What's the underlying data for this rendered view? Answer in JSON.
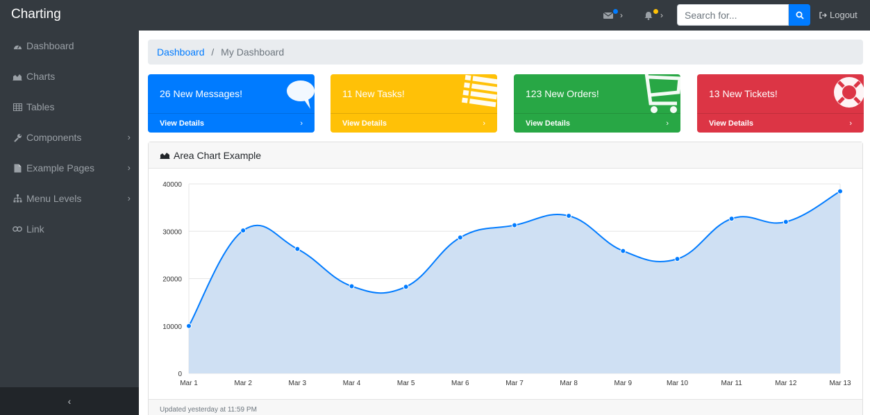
{
  "app": {
    "brand": "Charting"
  },
  "navbar": {
    "search_placeholder": "Search for...",
    "logout_label": "Logout",
    "messages_dot_color": "#007bff",
    "alerts_dot_color": "#ffc107"
  },
  "sidebar": {
    "items": [
      {
        "label": "Dashboard",
        "icon": "dashboard-icon"
      },
      {
        "label": "Charts",
        "icon": "area-chart-icon"
      },
      {
        "label": "Tables",
        "icon": "table-icon"
      },
      {
        "label": "Components",
        "icon": "wrench-icon",
        "expandable": true
      },
      {
        "label": "Example Pages",
        "icon": "file-icon",
        "expandable": true
      },
      {
        "label": "Menu Levels",
        "icon": "sitemap-icon",
        "expandable": true
      },
      {
        "label": "Link",
        "icon": "link-icon"
      }
    ],
    "toggle_label": "‹"
  },
  "breadcrumb": {
    "link": "Dashboard",
    "current": "My Dashboard"
  },
  "cards": [
    {
      "title": "26 New Messages!",
      "footer": "View Details",
      "color": "#007bff",
      "icon": "comments-icon"
    },
    {
      "title": "11 New Tasks!",
      "footer": "View Details",
      "color": "#ffc107",
      "icon": "list-icon"
    },
    {
      "title": "123 New Orders!",
      "footer": "View Details",
      "color": "#28a745",
      "icon": "shopping-cart-icon"
    },
    {
      "title": "13 New Tickets!",
      "footer": "View Details",
      "color": "#dc3545",
      "icon": "support-icon"
    }
  ],
  "chart_card": {
    "title": "Area Chart Example",
    "footer": "Updated yesterday at 11:59 PM"
  },
  "chart_data": {
    "type": "area",
    "categories": [
      "Mar 1",
      "Mar 2",
      "Mar 3",
      "Mar 4",
      "Mar 5",
      "Mar 6",
      "Mar 7",
      "Mar 8",
      "Mar 9",
      "Mar 10",
      "Mar 11",
      "Mar 12",
      "Mar 13"
    ],
    "values": [
      10000,
      30162,
      26263,
      18394,
      18287,
      28682,
      31274,
      33259,
      25849,
      24159,
      32651,
      31984,
      38451
    ],
    "ylim": [
      0,
      40000
    ],
    "yticks": [
      0,
      10000,
      20000,
      30000,
      40000
    ],
    "grid": true,
    "line_color": "#007bff",
    "fill_color": "#cfe0f3"
  }
}
